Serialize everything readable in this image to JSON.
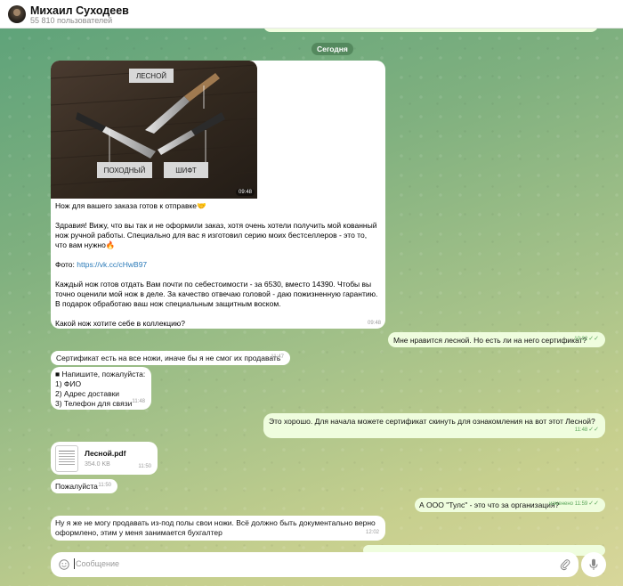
{
  "header": {
    "title": "Михаил Суходеев",
    "subtitle": "55 810 пользователей"
  },
  "date_divider": "Сегодня",
  "photo_labels": {
    "forest": "ЛЕСНОЙ",
    "hiking": "ПОХОДНЫЙ",
    "shift": "ШИФТ",
    "time": "09:48"
  },
  "messages": {
    "m1": {
      "p1": "Нож для вашего заказа готов к отправке🤝",
      "p2": "Здравия! Вижу, что вы так и не оформили заказ, хотя очень хотели получить мой кованный нож ручной работы. Специально для вас я изготовил серию моих бестселлеров - это то, что вам нужно🔥",
      "p3_label": "Фото: ",
      "p3_link": "https://vk.cc/cHwB97",
      "p4": "Каждый нож готов отдать Вам почти по себестоимости - за 6530, вместо 14390. Чтобы вы точно оценили мой нож в деле. За качество отвечаю головой - даю пожизненную гарантию. В подарок обработаю ваш нож специальным защитным воском.",
      "p5": "Какой нож хотите себе в коллекцию?",
      "time": "09:48"
    },
    "m2": {
      "text": "Мне нравится лесной. Но есть ли на него сертификат?",
      "time": "10:02"
    },
    "m3": {
      "text": "Сертификат есть на все ножи, иначе бы я не смог их продавать",
      "time": "11:47"
    },
    "m4": {
      "l1": "■ Напишите, пожалуйста:",
      "l2": "1) ФИО",
      "l3": "2) Адрес доставки",
      "l4": " 3) Телефон для связи",
      "time": "11:48"
    },
    "m5": {
      "text": "Это хорошо. Для начала можете сертификат скинуть для ознакомления на вот этот Лесной?",
      "time": "11:48"
    },
    "m6": {
      "name": "Лесной.pdf",
      "size": "354.0 KB",
      "time": "11:50"
    },
    "m7": {
      "text": "Пожалуйста",
      "time": "11:50"
    },
    "m8": {
      "text": "А ООО \"Тулс\" - это что за организация?",
      "edited": "изменено 11:59"
    },
    "m9": {
      "text": "Ну я же не могу продавать из-под полы свои ножи. Всё должно быть документально верно оформлено, этим у меня занимается бухгалтер",
      "time": "12:02"
    }
  },
  "composer": {
    "placeholder": "Сообщение"
  },
  "colors": {
    "accent": "#5aa65a",
    "outgoing": "#effdde",
    "link": "#2a7ab8"
  }
}
